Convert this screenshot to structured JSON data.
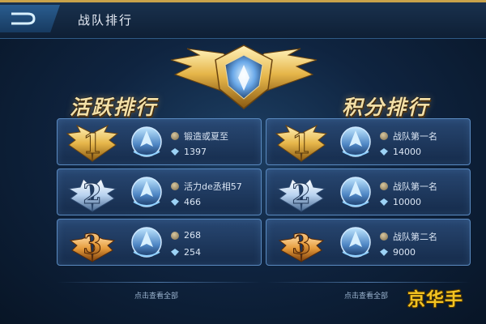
{
  "header": {
    "title": "战队排行",
    "back_icon": "back-arrow-icon"
  },
  "active_ranking": {
    "title": "活跃排行",
    "rows": [
      {
        "rank": "1",
        "badge_icon": "medal-gold-1",
        "line1": "锻造或夏至",
        "line2": "1397"
      },
      {
        "rank": "2",
        "badge_icon": "medal-silver-2",
        "line1": "活力de丞相57",
        "line2": "466"
      },
      {
        "rank": "3",
        "badge_icon": "medal-bronze-3",
        "line1": "268",
        "line2": "254"
      }
    ],
    "view_all": "点击查看全部"
  },
  "score_ranking": {
    "title": "积分排行",
    "rows": [
      {
        "rank": "1",
        "badge_icon": "medal-gold-1",
        "line1": "战队第一名",
        "line2": "14000"
      },
      {
        "rank": "2",
        "badge_icon": "medal-silver-2",
        "line1": "战队第一名",
        "line2": "10000"
      },
      {
        "rank": "3",
        "badge_icon": "medal-bronze-3",
        "line1": "战队第二名",
        "line2": "9000"
      }
    ],
    "view_all": "点击查看全部"
  },
  "watermark": "京华手",
  "colors": {
    "gold": "#f2c95a",
    "silver": "#b9d3f0",
    "bronze": "#e59a3a",
    "panel_border": "#5a8ac0",
    "watermark": "#f4c422"
  }
}
